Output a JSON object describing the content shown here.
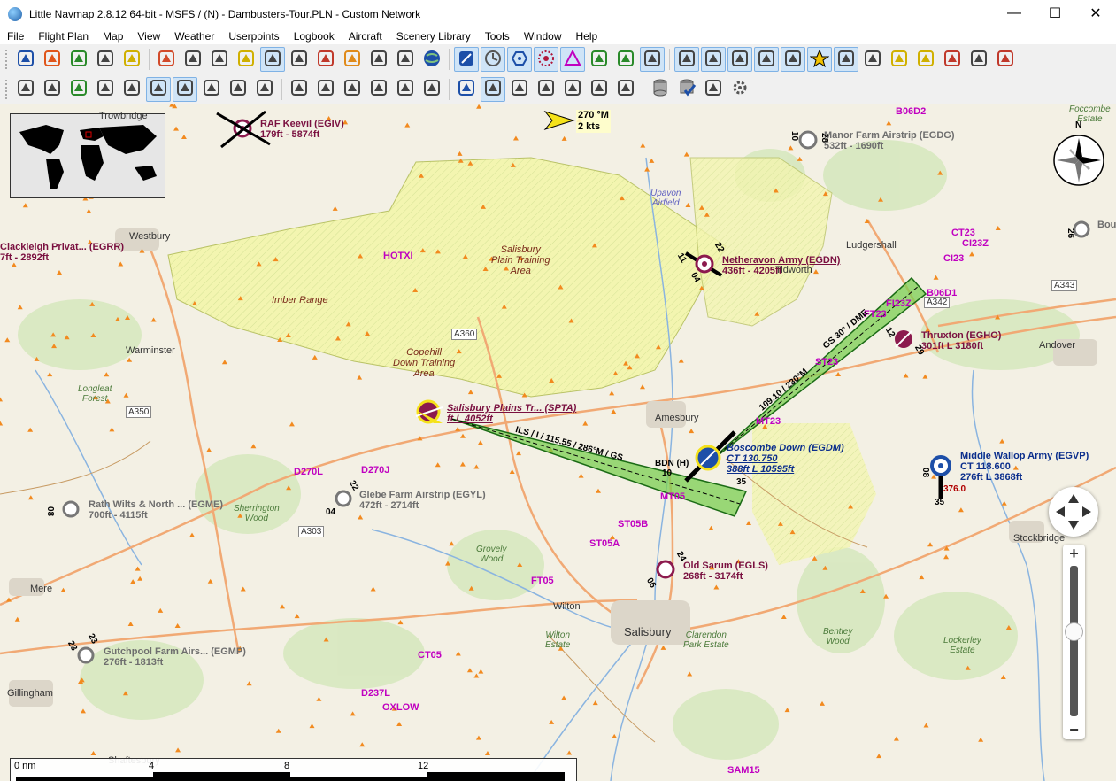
{
  "window": {
    "title": "Little Navmap 2.8.12 64-bit - MSFS / (N) - Dambusters-Tour.PLN - Custom Network",
    "minimize": "—",
    "maximize": "☐",
    "close": "✕"
  },
  "menu": [
    "File",
    "Flight Plan",
    "Map",
    "View",
    "Weather",
    "Userpoints",
    "Logbook",
    "Aircraft",
    "Scenery Library",
    "Tools",
    "Window",
    "Help"
  ],
  "toolbar1": [
    "new-flight-plan-icon",
    "open-flight-plan-icon",
    "save-flight-plan-icon",
    "save-as-icon",
    "reload-icon",
    "home-icon",
    "center-marker-icon",
    "route-icon",
    "aircraft-icon",
    "fit-route-icon",
    "clear-selection-icon",
    "remove-marks-icon",
    "back-icon",
    "print-icon",
    "distance-measure-icon",
    "globe-icon",
    "airport-filter-icon",
    "procedure-icon",
    "vor-icon",
    "ndb-icon",
    "waypoint-icon",
    "ils-icon",
    "marker-icon",
    "holding-icon",
    "msa-icon",
    "victor-airway-icon",
    "jet-airway-icon",
    "track-icon",
    "airspace-icon",
    "favorite-icon",
    "flight-path-icon",
    "trail-icon",
    "user-aircraft-icon",
    "ai-aircraft-icon",
    "compass-rose-icon",
    "ai-vehicle-icon",
    "online-icon"
  ],
  "toolbar2": [
    "undo-icon",
    "redo-icon",
    "select-departure-icon",
    "add-waypoint-icon",
    "direct-icon",
    "edit-route-icon",
    "insert-route-icon",
    "reverse-route-icon",
    "calc-route-icon",
    "show-ils-icon",
    "zoom-map-icon",
    "search-map-icon",
    "route-vertical-icon",
    "info-icon",
    "profile-icon",
    "sim-aircraft-icon",
    "compass-icon",
    "user-airspace-icon",
    "icao-airspace-icon",
    "restricted-airspace-icon",
    "special-airspace-icon",
    "other-airspace-icon",
    "fir-airspace-icon",
    "database-icon",
    "database-check-icon",
    "export-icon",
    "settings-icon"
  ],
  "map": {
    "wind": {
      "line1": "270 °M",
      "line2": "2 kts"
    },
    "towns": [
      {
        "name": "Trowbridge"
      },
      {
        "name": "Westbury"
      },
      {
        "name": "Warminster"
      },
      {
        "name": "Amesbury"
      },
      {
        "name": "Ludgershall"
      },
      {
        "name": "Tidworth"
      },
      {
        "name": "Andover"
      },
      {
        "name": "Stockbridge"
      },
      {
        "name": "Salisbury"
      },
      {
        "name": "Wilton"
      },
      {
        "name": "Mere"
      },
      {
        "name": "Gillingham"
      },
      {
        "name": "Shaftesbury"
      }
    ],
    "woods": [
      {
        "name": "Longleat\nForest"
      },
      {
        "name": "Sherrington\nWood"
      },
      {
        "name": "Grovely\nWood"
      },
      {
        "name": "Wilton\nEstate"
      },
      {
        "name": "Clarendon\nPark Estate"
      },
      {
        "name": "Bentley\nWood"
      },
      {
        "name": "Lockerley\nEstate"
      },
      {
        "name": "Upavon\nAirfield"
      },
      {
        "name": "Foccombe\nEstate"
      }
    ],
    "areas": [
      {
        "name": "Salisbury\nPlain Training\nArea"
      },
      {
        "name": "Imber Range"
      },
      {
        "name": "Copehill\nDown Training\nArea"
      }
    ],
    "roads": [
      "A360",
      "A350",
      "A303",
      "A343",
      "A342"
    ],
    "airports": [
      {
        "name": "RAF Keevil (EGIV)",
        "sub": "179ft - 5874ft"
      },
      {
        "name": "Manor Farm Airstrip (EGDG)",
        "sub": "532ft - 1690ft"
      },
      {
        "name": "Netheravon Army (EGDN)",
        "sub": "436ft - 4205ft"
      },
      {
        "name": "Thruxton (EGHO)",
        "sub": "301ft L 3180ft"
      },
      {
        "name": "Salisbury Plains Tr... (SPTA)",
        "sub": "ft L 4052ft"
      },
      {
        "name": "Boscombe Down (EGDM)",
        "sub": "CT 130.750",
        "sub2": "388ft L 10595ft"
      },
      {
        "name": "Middle Wallop Army (EGVP)",
        "sub": "CT 118.600",
        "sub2": "276ft L 3868ft"
      },
      {
        "name": "Glebe Farm Airstrip (EGYL)",
        "sub": "472ft - 2714ft"
      },
      {
        "name": "Old Sarum (EGLS)",
        "sub": "268ft - 3174ft"
      },
      {
        "name": "Gutchpool Farm Airs... (EGMP)",
        "sub": "276ft - 1813ft"
      },
      {
        "name": "Rath Wilts & North ... (EGME)",
        "sub": "700ft - 4115ft"
      },
      {
        "name": "Clackleigh Privat... (EGRR)",
        "sub": "7ft - 2892ft"
      },
      {
        "name": "Bou",
        "sub": ""
      }
    ],
    "waypoints": [
      "B06D2",
      "HOTXI",
      "CT23",
      "CI23Z",
      "CI23",
      "B06D1",
      "FI23Z",
      "FT23",
      "ST23",
      "MT23",
      "MT05",
      "ST05B",
      "ST05A",
      "FT05",
      "D270L",
      "D270J",
      "CT05",
      "D237L",
      "OXLOW",
      "SAM15"
    ],
    "ils": [
      {
        "label": "ILS / I / 115.55 / 286°M / GS"
      },
      {
        "label": "GS 30° / DME"
      },
      {
        "label": "109.10 / 230°M"
      },
      {
        "label": "ILS / ..."
      }
    ],
    "runway_labels": [
      "10",
      "28",
      "22",
      "04",
      "11",
      "29",
      "12",
      "30",
      "05",
      "23",
      "35",
      "08",
      "26",
      "24",
      "06",
      "376.0",
      "BDN (H)",
      "10"
    ],
    "scale": {
      "labels": [
        "0 nm",
        "4",
        "8",
        "12"
      ]
    },
    "compass": {
      "north": "N"
    },
    "zoom": {
      "plus": "+",
      "minus": "−"
    }
  }
}
